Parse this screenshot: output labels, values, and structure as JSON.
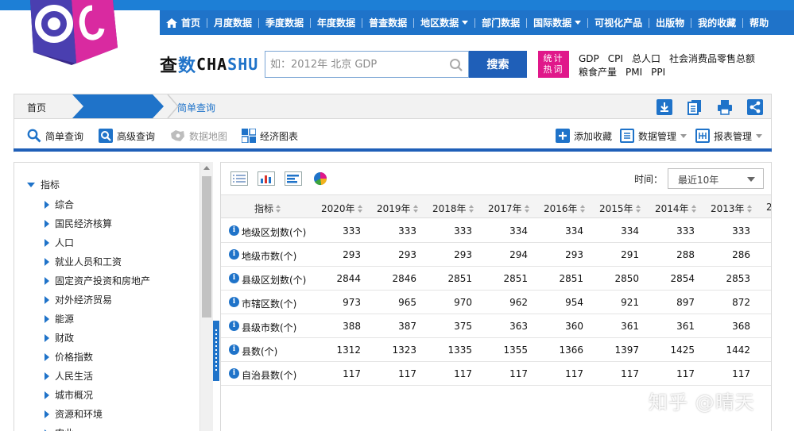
{
  "nav": {
    "items": [
      "首页",
      "月度数据",
      "季度数据",
      "年度数据",
      "普查数据",
      "地区数据",
      "部门数据",
      "国际数据",
      "可视化产品",
      "出版物",
      "我的收藏",
      "帮助"
    ]
  },
  "brand": {
    "a": "查",
    "b": "数",
    "c": "CHA",
    "d": "SHU"
  },
  "search": {
    "placeholder": "如：2012年 北京 GDP",
    "button": "搜索"
  },
  "hot": {
    "badge_line1": "统计",
    "badge_line2": "热词",
    "row1": [
      "GDP",
      "CPI",
      "总人口",
      "社会消费品零售总额"
    ],
    "row2": [
      "粮食产量",
      "PMI",
      "PPI"
    ]
  },
  "breadcrumb": {
    "home": "首页",
    "active": "年度数据",
    "last": "简单查询"
  },
  "query_toolbar": {
    "simple": "简单查询",
    "advanced": "高级查询",
    "map": "数据地图",
    "chart": "经济图表",
    "favorite": "添加收藏",
    "data_mgmt": "数据管理",
    "report_mgmt": "报表管理"
  },
  "tree": {
    "root": "指标",
    "items": [
      "综合",
      "国民经济核算",
      "人口",
      "就业人员和工资",
      "固定资产投资和房地产",
      "对外经济贸易",
      "能源",
      "财政",
      "价格指数",
      "人民生活",
      "城市概况",
      "资源和环境",
      "农业"
    ]
  },
  "panel": {
    "time_label": "时间：",
    "time_value": "最近10年"
  },
  "table": {
    "header_indicator": "指标",
    "years": [
      "2020年",
      "2019年",
      "2018年",
      "2017年",
      "2016年",
      "2015年",
      "2014年",
      "2013年",
      "2"
    ],
    "rows": [
      {
        "name": "地级区划数(个)",
        "values": [
          "333",
          "333",
          "333",
          "334",
          "334",
          "334",
          "333",
          "333"
        ]
      },
      {
        "name": "地级市数(个)",
        "values": [
          "293",
          "293",
          "293",
          "294",
          "293",
          "291",
          "288",
          "286"
        ]
      },
      {
        "name": "县级区划数(个)",
        "values": [
          "2844",
          "2846",
          "2851",
          "2851",
          "2851",
          "2850",
          "2854",
          "2853"
        ]
      },
      {
        "name": "市辖区数(个)",
        "values": [
          "973",
          "965",
          "970",
          "962",
          "954",
          "921",
          "897",
          "872"
        ]
      },
      {
        "name": "县级市数(个)",
        "values": [
          "388",
          "387",
          "375",
          "363",
          "360",
          "361",
          "361",
          "368"
        ]
      },
      {
        "name": "县数(个)",
        "values": [
          "1312",
          "1323",
          "1335",
          "1355",
          "1366",
          "1397",
          "1425",
          "1442"
        ]
      },
      {
        "name": "自治县数(个)",
        "values": [
          "117",
          "117",
          "117",
          "117",
          "117",
          "117",
          "117",
          "117"
        ]
      }
    ]
  },
  "watermark": "知乎 @晴天",
  "colors": {
    "nav_blue": "#1f73c9",
    "accent_blue": "#1f5fb8",
    "hot_pink": "#e0188a"
  }
}
